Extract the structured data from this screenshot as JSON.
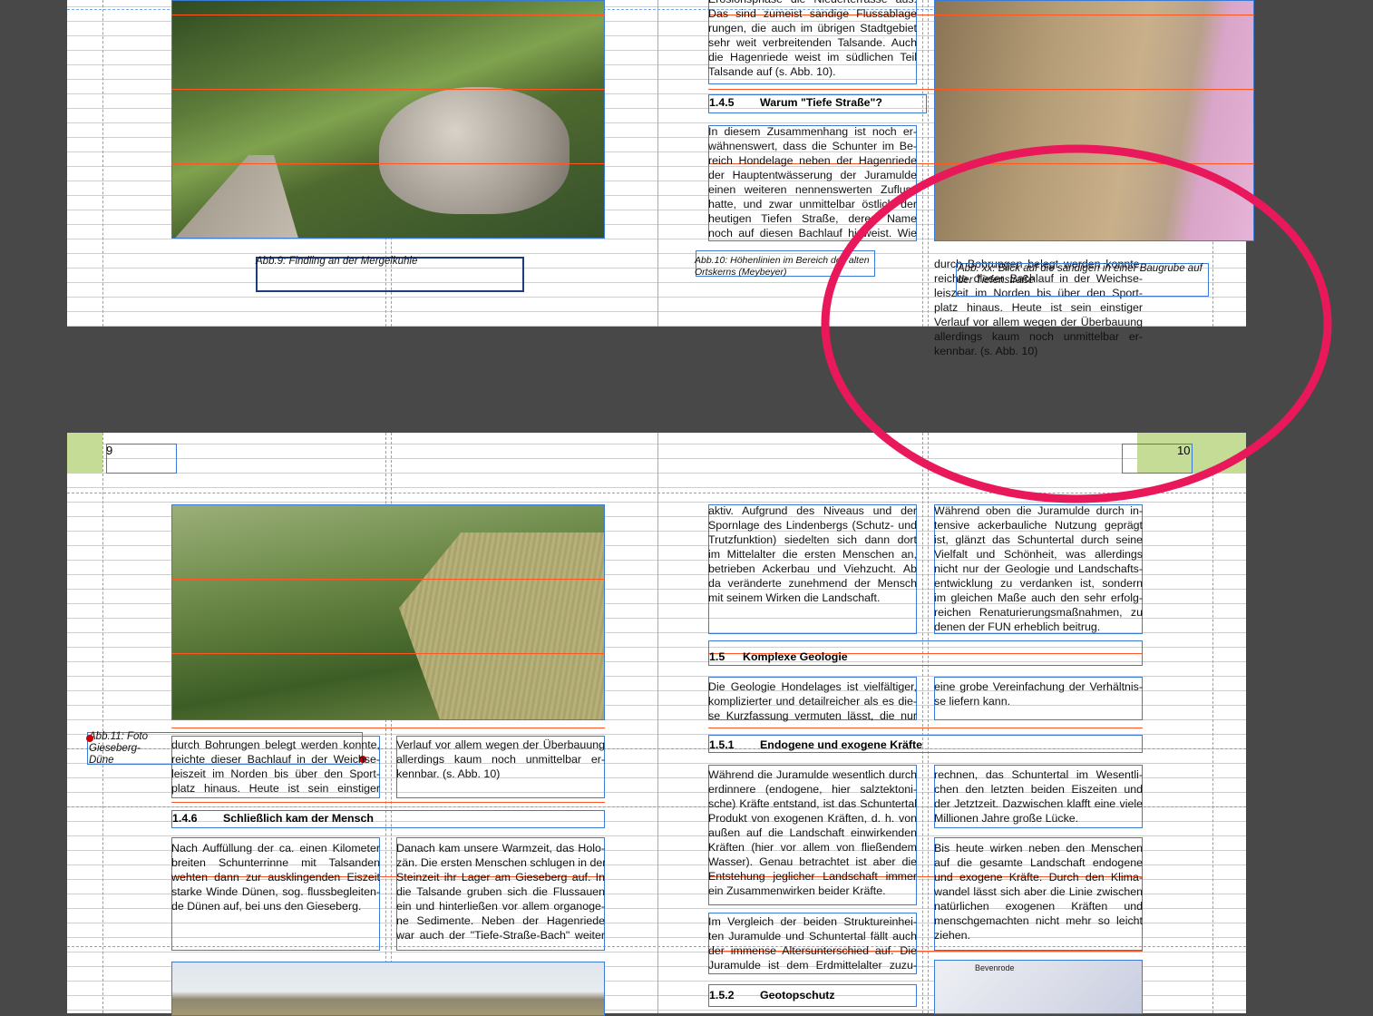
{
  "top": {
    "captions": {
      "abb9": "Abb.9: Findling an der Mergelkuhle",
      "abb10": [
        "Abb.10: Höhenlinien im Bereich des alten",
        "Ortskerns (Meybeyer)"
      ],
      "abbxx": [
        "Abb. xx: Blick auf die sandigen in einer Baugrube auf",
        "der Tiefenstraße"
      ]
    },
    "heading_145": {
      "num": "1.4.5",
      "title": "Warum \"Tiefe Straße\"?"
    },
    "blocks": [
      {
        "lines": [
          "Erosionsphase die Niederterrasse aus.",
          "Das sind zumeist sandige Flussablage",
          "rungen, die auch im übrigen Stadtgebiet",
          "sehr weit verbreitenden Talsande. Auch",
          "die Hagenriede weist im südlichen Teil",
          "Talsande auf (s. Abb. 10)."
        ],
        "last": true
      },
      {
        "lines": [
          "In diesem Zusammenhang ist noch er-",
          "wähnenswert, dass die Schunter im Be-",
          "reich Hondelage neben der Hagenriede",
          "der Hauptentwässerung der Juramulde",
          "einen weiteren nennenswerten Zufluss",
          "hatte, und zwar unmittelbar östlich der",
          "heutigen Tiefen Straße, deren Name",
          "noch auf diesen Bachlauf hinweist. Wie"
        ],
        "last": false
      },
      {
        "lines": [
          "durch Bohrungen belegt werden konnte,",
          "reichte dieser Bachlauf in der Weichse-",
          "leiszeit im Norden bis über den Sport-",
          "platz hinaus. Heute ist sein einstiger",
          "Verlauf vor allem wegen der Überbauung",
          "allerdings kaum noch unmittelbar er-",
          "kennbar. (s. Abb. 10)"
        ],
        "last": true
      }
    ]
  },
  "bottom": {
    "page_left": "9",
    "page_right": "10",
    "caption_abb11": [
      "Abb.11: Foto",
      "Gieseberg-",
      "Düne"
    ],
    "heading_146": {
      "num": "1.4.6",
      "title": "Schließlich kam der Mensch"
    },
    "heading_15": {
      "num": "1.5",
      "title": "Komplexe Geologie"
    },
    "heading_151": {
      "num": "1.5.1",
      "title": "Endogene und exogene Kräfte"
    },
    "heading_152": {
      "num": "1.5.2",
      "title": "Geotopschutz"
    },
    "map_label": "Bevenrode",
    "blocks": [
      {
        "lines": [
          "durch Bohrungen belegt werden konnte,",
          "reichte dieser Bachlauf in der Weichse-",
          "leiszeit im Norden bis über den Sport-",
          "platz hinaus. Heute ist sein einstiger"
        ],
        "last": false
      },
      {
        "lines": [
          "Verlauf vor allem wegen der Überbauung",
          "allerdings kaum noch unmittelbar er-",
          "kennbar. (s. Abb. 10)"
        ],
        "last": true
      },
      {
        "lines": [
          "Nach Auffüllung der ca. einen Kilometer",
          "breiten Schunterrinne mit Talsanden",
          "wehten dann zur ausklingenden Eiszeit",
          "starke Winde Dünen, sog. flussbegleiten-",
          "de Dünen auf, bei uns den Gieseberg."
        ],
        "last": true
      },
      {
        "lines": [
          "Danach kam unsere Warmzeit, das Holo-",
          "zän. Die ersten Menschen schlugen in der",
          "Steinzeit ihr Lager am Gieseberg auf. In",
          "die Talsande gruben sich die Flussauen",
          "ein und hinterließen vor allem organoge-",
          "ne Sedimente. Neben der Hagenriede",
          "war auch der \"Tiefe-Straße-Bach\" weiter"
        ],
        "last": false
      },
      {
        "lines": [
          "aktiv. Aufgrund des Niveaus und der",
          "Spornlage des Lindenbergs (Schutz- und",
          "Trutzfunktion) siedelten sich dann dort",
          "im Mittelalter die ersten Menschen an,",
          "betrieben Ackerbau und Viehzucht. Ab",
          "da veränderte zunehmend der Mensch",
          "mit seinem Wirken die Landschaft."
        ],
        "last": true
      },
      {
        "lines": [
          "Während oben die Juramulde durch in-",
          "tensive ackerbauliche Nutzung geprägt",
          "ist, glänzt das Schuntertal durch seine",
          "Vielfalt und Schönheit, was allerdings",
          "nicht nur der Geologie und Landschafts-",
          "entwicklung zu verdanken ist, sondern",
          "im gleichen Maße auch den sehr erfolg-",
          "reichen Renaturierungsmaßnahmen, zu",
          "denen der FUN erheblich beitrug."
        ],
        "last": true
      },
      {
        "lines": [
          "Die Geologie Hondelages ist vielfältiger,",
          "komplizierter und detailreicher als es die-",
          "se Kurzfassung vermuten lässt, die nur"
        ],
        "last": false
      },
      {
        "lines": [
          "eine grobe Vereinfachung der Verhältnis-",
          "se liefern kann."
        ],
        "last": true
      },
      {
        "lines": [
          "Während die Juramulde wesentlich durch",
          "erdinnere (endogene, hier salztektoni-",
          "sche) Kräfte entstand, ist das Schuntertal",
          "Produkt von exogenen Kräften, d. h. von",
          "außen auf die Landschaft einwirkenden",
          "Kräften (hier vor allem von fließendem",
          "Wasser). Genau betrachtet ist aber die",
          "Entstehung jeglicher Landschaft immer",
          "ein Zusammenwirken beider Kräfte."
        ],
        "last": true
      },
      {
        "lines": [
          "Im Vergleich der beiden Struktureinhei-",
          "ten Juramulde und Schuntertal fällt auch",
          "der immense Altersunterschied auf. Die",
          "Juramulde ist dem Erdmittelalter zuzu-"
        ],
        "last": false
      },
      {
        "lines": [
          "rechnen, das Schuntertal im Wesentli-",
          "chen den letzten beiden Eiszeiten und",
          "der Jetztzeit. Dazwischen klafft eine viele",
          "Millionen Jahre große Lücke."
        ],
        "last": true
      },
      {
        "lines": [
          "Bis heute wirken neben den Menschen",
          "auf die gesamte Landschaft endogene",
          "und exogene Kräfte. Durch den Klima-",
          "wandel lässt sich aber die Linie zwischen",
          "natürlichen exogenen Kräften und",
          "menschgemachten nicht mehr so leicht",
          "ziehen."
        ],
        "last": true
      }
    ]
  },
  "colors": {
    "annotation": "#e8185a",
    "frame": "#3a7bd5",
    "guide_line": "#ff5722",
    "page_marker": "#c5dc96"
  }
}
